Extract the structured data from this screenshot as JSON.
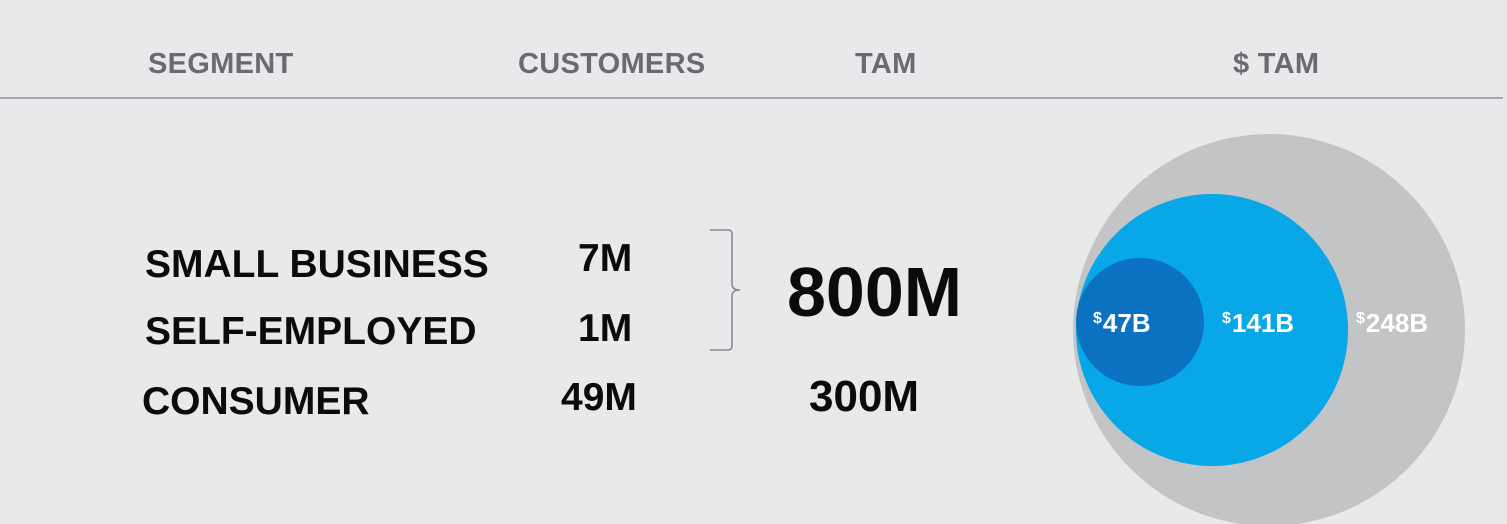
{
  "header": {
    "segment": "SEGMENT",
    "customers": "CUSTOMERS",
    "tam": "TAM",
    "dollar_tam": "$ TAM"
  },
  "rows": [
    {
      "segment": "SMALL BUSINESS",
      "customers": "7M"
    },
    {
      "segment": "SELF-EMPLOYED",
      "customers": "1M"
    },
    {
      "segment": "CONSUMER",
      "customers": "49M"
    }
  ],
  "tam_values": {
    "business_combined": "800M",
    "consumer": "300M"
  },
  "chart_data": {
    "type": "bubble",
    "title": "$ TAM",
    "bubbles": [
      {
        "currency": "$",
        "value_label": "248B",
        "value": 248,
        "color": "#c3c4c6"
      },
      {
        "currency": "$",
        "value_label": "141B",
        "value": 141,
        "color": "#08a7e8"
      },
      {
        "currency": "$",
        "value_label": "47B",
        "value": 47,
        "color": "#0a72c0"
      }
    ]
  },
  "colors": {
    "background": "#e8e9ea",
    "header_text": "#6a6b70",
    "rule": "#a7a8ac",
    "body_text": "#0b0b0b"
  }
}
